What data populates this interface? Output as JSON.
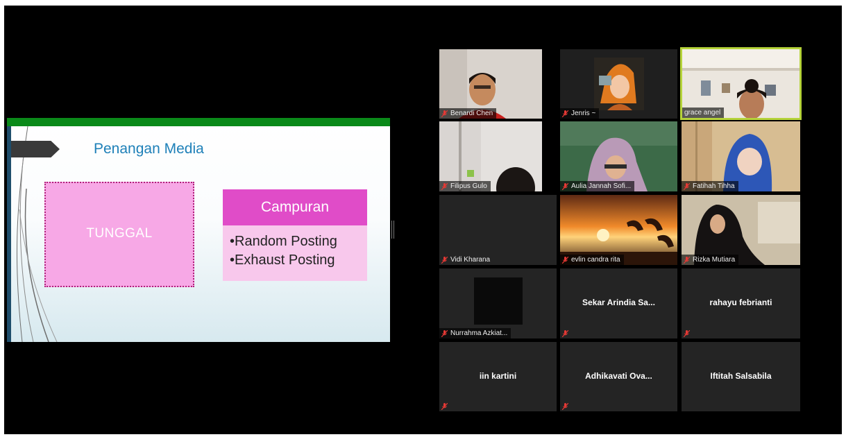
{
  "slide": {
    "title": "Penangan Media",
    "box_left": "TUNGGAL",
    "box_right": {
      "header": "Campuran",
      "items": [
        "•Random Posting",
        "•Exhaust Posting"
      ]
    },
    "colors": {
      "topbar": "#0a8a19",
      "title": "#1e80b8",
      "pink_box": "#f7a8e6",
      "campuran_header": "#e04cc8",
      "campuran_body": "#f8c8ec"
    }
  },
  "participants": [
    {
      "name": "Benardi Chen",
      "style": "video"
    },
    {
      "name": "Jenris ~",
      "style": "video"
    },
    {
      "name": "grace angel",
      "style": "video",
      "active_speaker": true
    },
    {
      "name": "Filipus Gulo",
      "style": "video"
    },
    {
      "name": "Aulia Jannah Sofi...",
      "style": "video"
    },
    {
      "name": "Fatihah Tihha",
      "style": "video"
    },
    {
      "name": "Vidi Kharana",
      "style": "label"
    },
    {
      "name": "evlin candra rita",
      "style": "video"
    },
    {
      "name": "Rizka Mutiara",
      "style": "video"
    },
    {
      "name": "Nurrahma Azkiat...",
      "style": "video"
    },
    {
      "name": "Sekar Arindia Sa...",
      "style": "center"
    },
    {
      "name": "rahayu febrianti",
      "style": "center"
    },
    {
      "name": "iin kartini",
      "style": "center"
    },
    {
      "name": "Adhikavati Ova...",
      "style": "center"
    },
    {
      "name": "Iftitah Salsabila",
      "style": "center"
    }
  ],
  "icons": {
    "muted": "mic-muted-icon"
  },
  "colors": {
    "background": "#000000",
    "tile": "#242424",
    "active_border": "#b5d33a",
    "muted_icon": "#e53935"
  }
}
